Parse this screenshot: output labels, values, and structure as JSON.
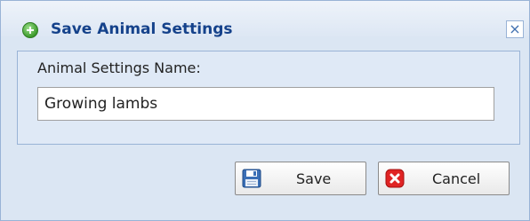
{
  "dialog": {
    "title": "Save Animal Settings",
    "title_icon": "add-circle-icon",
    "close_icon": "close-icon",
    "close_symbol": "×"
  },
  "form": {
    "label": "Animal Settings Name:",
    "name_value": "Growing lambs"
  },
  "buttons": {
    "save_label": "Save",
    "save_icon": "floppy-disk-icon",
    "cancel_label": "Cancel",
    "cancel_icon": "red-x-icon"
  },
  "colors": {
    "title_text": "#15428b",
    "dialog_background": "#dbe6f3",
    "border": "#99b3d6"
  }
}
